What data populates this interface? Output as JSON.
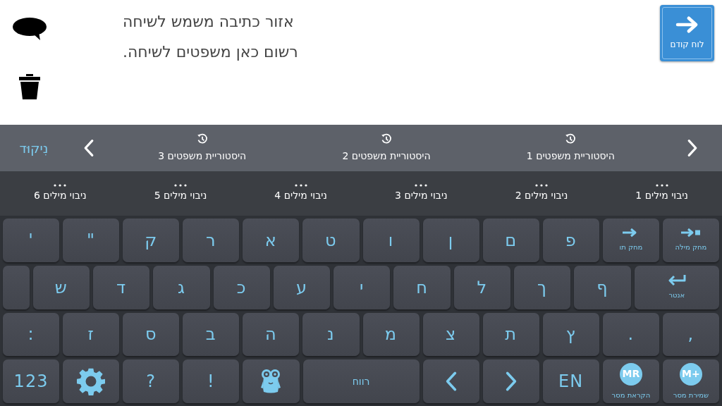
{
  "text_area": {
    "lines": [
      "אזור כתיבה משמש לשיחה",
      "רשום כאן משפטים לשיחה."
    ]
  },
  "back_button": {
    "label": "לוח קודם"
  },
  "sentence_bar": {
    "history": [
      "היסטוריית משפטים 1",
      "היסטוריית משפטים 2",
      "היסטוריית משפטים 3"
    ],
    "niqqud": "נִיקוּד"
  },
  "word_predictions": [
    "ניבוי מילים 1",
    "ניבוי מילים 2",
    "ניבוי מילים 3",
    "ניבוי מילים 4",
    "ניבוי מילים 5",
    "ניבוי מילים 6"
  ],
  "keyboard": {
    "letter_row_1": [
      {
        "kind": "delete_word",
        "sublabel": "מחק מילה"
      },
      {
        "kind": "delete_char",
        "sublabel": "מחק תו"
      },
      {
        "kind": "char",
        "label": "פ"
      },
      {
        "kind": "char",
        "label": "ם"
      },
      {
        "kind": "char",
        "label": "ן"
      },
      {
        "kind": "char",
        "label": "ו"
      },
      {
        "kind": "char",
        "label": "ט"
      },
      {
        "kind": "char",
        "label": "א"
      },
      {
        "kind": "char",
        "label": "ר"
      },
      {
        "kind": "char",
        "label": "ק"
      },
      {
        "kind": "char",
        "label": "\""
      },
      {
        "kind": "char",
        "label": "'"
      }
    ],
    "letter_row_2": [
      {
        "kind": "enter",
        "sublabel": "אנטר"
      },
      {
        "kind": "char",
        "label": "ף"
      },
      {
        "kind": "char",
        "label": "ך"
      },
      {
        "kind": "char",
        "label": "ל"
      },
      {
        "kind": "char",
        "label": "ח"
      },
      {
        "kind": "char",
        "label": "י"
      },
      {
        "kind": "char",
        "label": "ע"
      },
      {
        "kind": "char",
        "label": "כ"
      },
      {
        "kind": "char",
        "label": "ג"
      },
      {
        "kind": "char",
        "label": "ד"
      },
      {
        "kind": "char",
        "label": "ש"
      },
      {
        "kind": "blank"
      }
    ],
    "letter_row_3": [
      {
        "kind": "char",
        "label": ","
      },
      {
        "kind": "char",
        "label": "."
      },
      {
        "kind": "char",
        "label": "ץ"
      },
      {
        "kind": "char",
        "label": "ת"
      },
      {
        "kind": "char",
        "label": "צ"
      },
      {
        "kind": "char",
        "label": "מ"
      },
      {
        "kind": "char",
        "label": "נ"
      },
      {
        "kind": "char",
        "label": "ה"
      },
      {
        "kind": "char",
        "label": "ב"
      },
      {
        "kind": "char",
        "label": "ס"
      },
      {
        "kind": "char",
        "label": "ז"
      },
      {
        "kind": "char",
        "label": ":"
      }
    ],
    "function_row": [
      {
        "kind": "memory",
        "label": "M+",
        "sublabel": "שמירת מסר"
      },
      {
        "kind": "memory",
        "label": "MR",
        "sublabel": "הקראת מסר"
      },
      {
        "kind": "char",
        "label": "EN"
      },
      {
        "kind": "right"
      },
      {
        "kind": "left"
      },
      {
        "kind": "space",
        "sublabel": "רווח"
      },
      {
        "kind": "emoji"
      },
      {
        "kind": "char",
        "label": "!"
      },
      {
        "kind": "char",
        "label": "?"
      },
      {
        "kind": "settings"
      },
      {
        "kind": "char",
        "label": "123"
      }
    ]
  }
}
